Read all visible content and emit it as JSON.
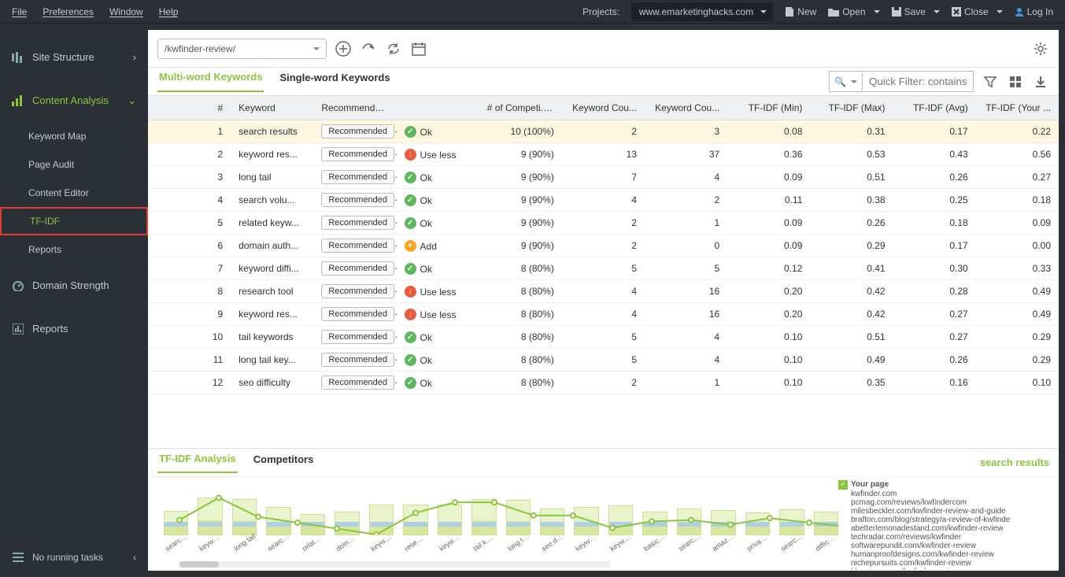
{
  "menubar": {
    "file": "File",
    "preferences": "Preferences",
    "window": "Window",
    "help": "Help"
  },
  "top_right": {
    "projects_label": "Projects:",
    "project": "www.emarketinghacks.com",
    "new": "New",
    "open": "Open",
    "save": "Save",
    "close": "Close",
    "login": "Log In"
  },
  "sidebar": {
    "site_structure": "Site Structure",
    "content_analysis": "Content Analysis",
    "subs": [
      "Keyword Map",
      "Page Audit",
      "Content Editor",
      "TF-IDF",
      "Reports"
    ],
    "domain_strength": "Domain Strength",
    "reports": "Reports",
    "no_tasks": "No running tasks"
  },
  "toolbar": {
    "url": "/kwfinder-review/"
  },
  "tabs": {
    "multi": "Multi-word Keywords",
    "single": "Single-word Keywords"
  },
  "filter_placeholder": "Quick Filter: contains",
  "columns": [
    "#",
    "Keyword",
    "Recommendation",
    "",
    "# of Competi... ▼",
    "Keyword Cou...",
    "Keyword Cou...",
    "TF-IDF (Min)",
    "TF-IDF (Max)",
    "TF-IDF (Avg)",
    "TF-IDF (Your ..."
  ],
  "rows": [
    {
      "n": 1,
      "kw": "search results",
      "rec": "Recommended",
      "st": "ok",
      "stl": "Ok",
      "comp": "10 (100%)",
      "c1": 2,
      "c2": 3,
      "min": "0.08",
      "max": "0.31",
      "avg": "0.17",
      "y": "0.22"
    },
    {
      "n": 2,
      "kw": "keyword res...",
      "rec": "Recommended",
      "st": "less",
      "stl": "Use less",
      "comp": "9 (90%)",
      "c1": 13,
      "c2": 37,
      "min": "0.36",
      "max": "0.53",
      "avg": "0.43",
      "y": "0.56"
    },
    {
      "n": 3,
      "kw": "long tail",
      "rec": "Recommended",
      "st": "ok",
      "stl": "Ok",
      "comp": "9 (90%)",
      "c1": 7,
      "c2": 4,
      "min": "0.09",
      "max": "0.51",
      "avg": "0.26",
      "y": "0.27"
    },
    {
      "n": 4,
      "kw": "search volu...",
      "rec": "Recommended",
      "st": "ok",
      "stl": "Ok",
      "comp": "9 (90%)",
      "c1": 4,
      "c2": 2,
      "min": "0.11",
      "max": "0.38",
      "avg": "0.25",
      "y": "0.18"
    },
    {
      "n": 5,
      "kw": "related keyw...",
      "rec": "Recommended",
      "st": "ok",
      "stl": "Ok",
      "comp": "9 (90%)",
      "c1": 2,
      "c2": 1,
      "min": "0.09",
      "max": "0.26",
      "avg": "0.18",
      "y": "0.09"
    },
    {
      "n": 6,
      "kw": "domain auth...",
      "rec": "Recommended",
      "st": "add",
      "stl": "Add",
      "comp": "9 (90%)",
      "c1": 2,
      "c2": 0,
      "min": "0.09",
      "max": "0.29",
      "avg": "0.17",
      "y": "0.00"
    },
    {
      "n": 7,
      "kw": "keyword diffi...",
      "rec": "Recommended",
      "st": "ok",
      "stl": "Ok",
      "comp": "8 (80%)",
      "c1": 5,
      "c2": 5,
      "min": "0.12",
      "max": "0.41",
      "avg": "0.30",
      "y": "0.33"
    },
    {
      "n": 8,
      "kw": "research tool",
      "rec": "Recommended",
      "st": "less",
      "stl": "Use less",
      "comp": "8 (80%)",
      "c1": 4,
      "c2": 16,
      "min": "0.20",
      "max": "0.42",
      "avg": "0.28",
      "y": "0.49"
    },
    {
      "n": 9,
      "kw": "keyword res...",
      "rec": "Recommended",
      "st": "less",
      "stl": "Use less",
      "comp": "8 (80%)",
      "c1": 4,
      "c2": 16,
      "min": "0.20",
      "max": "0.42",
      "avg": "0.27",
      "y": "0.49"
    },
    {
      "n": 10,
      "kw": "tail keywords",
      "rec": "Recommended",
      "st": "ok",
      "stl": "Ok",
      "comp": "8 (80%)",
      "c1": 5,
      "c2": 4,
      "min": "0.10",
      "max": "0.51",
      "avg": "0.27",
      "y": "0.29"
    },
    {
      "n": 11,
      "kw": "long tail key...",
      "rec": "Recommended",
      "st": "ok",
      "stl": "Ok",
      "comp": "8 (80%)",
      "c1": 5,
      "c2": 4,
      "min": "0.10",
      "max": "0.49",
      "avg": "0.26",
      "y": "0.29"
    },
    {
      "n": 12,
      "kw": "seo difficulty",
      "rec": "Recommended",
      "st": "ok",
      "stl": "Ok",
      "comp": "8 (80%)",
      "c1": 2,
      "c2": 1,
      "min": "0.10",
      "max": "0.35",
      "avg": "0.16",
      "y": "0.10"
    }
  ],
  "lower_tabs": {
    "analysis": "TF-IDF Analysis",
    "competitors": "Competitors",
    "right": "search results"
  },
  "legend": [
    "Your page",
    "kwfinder.com",
    "pcmag.com/reviews/kwfindercom",
    "milesbeckler.com/kwfinder-review-and-guide",
    "brafton.com/blog/strategy/a-review-of-kwfinde",
    "abetterlemonadestand.com/kwfinder-review",
    "techradar.com/reviews/kwfinder",
    "softwarepundit.com/kwfinder-review",
    "humanproofdesigns.com/kwfinder-review",
    "nichepursuits.com/kwfinder-review",
    "bloggingx.com/kwfinder-review"
  ],
  "chart_data": {
    "type": "bar",
    "title": "TF-IDF Analysis",
    "categories": [
      "search re...",
      "keyword re...",
      "long tail",
      "search vo...",
      "related ke...",
      "domain a...",
      "keyword d...",
      "research t...",
      "keyword re...",
      "tail keywo...",
      "long tail ke...",
      "seo difficu...",
      "keyword to...",
      "keyword ide...",
      "basic plan",
      "search en...",
      "amazon ke...",
      "privacy pol...",
      "search en...",
      "difficulty s..."
    ],
    "series": [
      {
        "name": "range_low",
        "values": [
          0.08,
          0.36,
          0.09,
          0.11,
          0.09,
          0.09,
          0.12,
          0.2,
          0.2,
          0.1,
          0.1,
          0.1,
          0.1,
          0.1,
          0.1,
          0.1,
          0.1,
          0.1,
          0.1,
          0.1
        ]
      },
      {
        "name": "range_high",
        "values": [
          0.31,
          0.53,
          0.51,
          0.38,
          0.26,
          0.29,
          0.41,
          0.42,
          0.42,
          0.51,
          0.49,
          0.35,
          0.38,
          0.4,
          0.3,
          0.35,
          0.32,
          0.28,
          0.33,
          0.3
        ]
      },
      {
        "name": "your_page",
        "values": [
          0.22,
          0.56,
          0.27,
          0.18,
          0.09,
          0.0,
          0.33,
          0.49,
          0.49,
          0.29,
          0.29,
          0.1,
          0.2,
          0.22,
          0.15,
          0.25,
          0.18,
          0.12,
          0.2,
          0.15
        ]
      }
    ],
    "ylim": [
      0,
      0.6
    ]
  }
}
